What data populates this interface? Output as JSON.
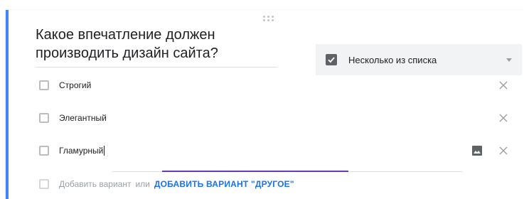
{
  "question": {
    "title": "Какое впечатление должен производить дизайн сайта?"
  },
  "type_select": {
    "label": "Несколько из списка",
    "icon": "checkbox-icon"
  },
  "options": [
    {
      "label": "Строгий"
    },
    {
      "label": "Элегантный"
    },
    {
      "label": "Гламурный"
    }
  ],
  "add_option": {
    "placeholder": "Добавить вариант",
    "or": "или",
    "add_other": "ДОБАВИТЬ ВАРИАНТ \"ДРУГОЕ\""
  },
  "colors": {
    "accent": "#4285f4",
    "focus": "#673ab7",
    "link": "#1a73e8"
  }
}
